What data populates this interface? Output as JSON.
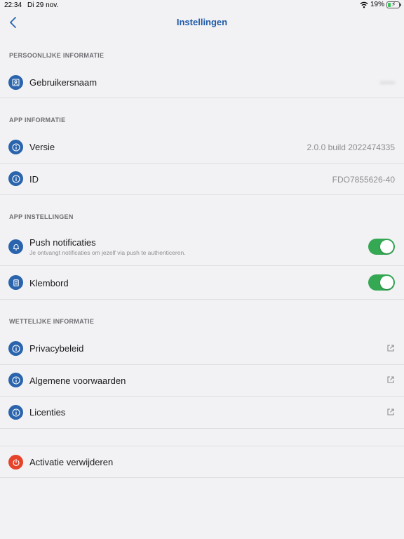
{
  "status_bar": {
    "time": "22:34",
    "date": "Di 29 nov.",
    "battery": "19%"
  },
  "nav": {
    "title": "Instellingen"
  },
  "sections": {
    "personal": {
      "header": "PERSOONLIJKE INFORMATIE",
      "username_label": "Gebruikersnaam",
      "username_value": "•••••"
    },
    "app_info": {
      "header": "APP INFORMATIE",
      "version_label": "Versie",
      "version_value": "2.0.0 build 2022474335",
      "id_label": "ID",
      "id_value": "FDO7855626-40"
    },
    "app_settings": {
      "header": "APP INSTELLINGEN",
      "push_label": "Push notificaties",
      "push_sub": "Je ontvangt notificaties om jezelf via push te authenticeren.",
      "push_enabled": true,
      "clipboard_label": "Klembord",
      "clipboard_enabled": true
    },
    "legal": {
      "header": "WETTELIJKE INFORMATIE",
      "privacy_label": "Privacybeleid",
      "terms_label": "Algemene voorwaarden",
      "licenses_label": "Licenties"
    },
    "danger": {
      "remove_label": "Activatie verwijderen"
    }
  },
  "colors": {
    "accent": "#2a64ad",
    "title": "#1f5aa6",
    "danger": "#e5432a",
    "toggle_on": "#34a853"
  }
}
